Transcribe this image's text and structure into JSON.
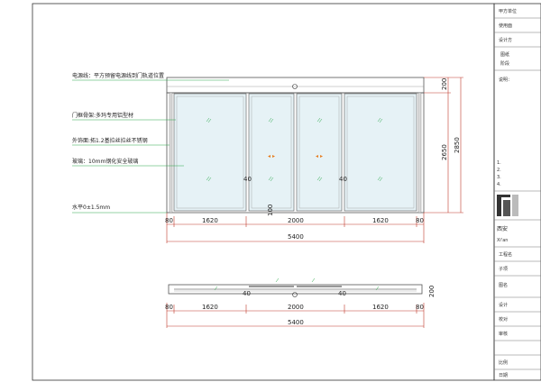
{
  "annotations": {
    "power_line": "电源线：平方预留电源线到门轨道位置",
    "leaf_frame": "门框骨架:多玛专用铝型材",
    "outer_decor": "外饰面:拓1.2基拉丝拉丝不锈钢",
    "glass": "玻璃：10mm钢化安全玻璃",
    "level": "水平0±1.5mm"
  },
  "elevation": {
    "widths": [
      "80",
      "1620",
      "2000",
      "1620",
      "80"
    ],
    "total": "5400",
    "gap_left": "40",
    "gap_right": "40",
    "bottom_gap": "100",
    "top_box": "200",
    "inner_height": "2650",
    "overall_height": "2850",
    "arrow_left": "◂ ▸",
    "arrow_right": "◂ ▸"
  },
  "plan": {
    "widths": [
      "80",
      "1620",
      "2000",
      "1620",
      "80"
    ],
    "total": "5400",
    "gap_left": "40",
    "gap_right": "40",
    "depth": "200"
  },
  "title_block": {
    "r1": "甲方单位",
    "r2": "使用面",
    "r3": "设计方",
    "r4a": "图纸",
    "r4b": "阶段",
    "r5": "说明：",
    "notes": [
      "1.",
      "2.",
      "3.",
      "4."
    ],
    "company": "西安",
    "company_en": "Xi'an",
    "f1": "工程名",
    "f2": "子项",
    "f3": "图名",
    "f4": "设计",
    "f5": "校对",
    "f6": "审核",
    "f7": "比例",
    "f8": "日期"
  }
}
